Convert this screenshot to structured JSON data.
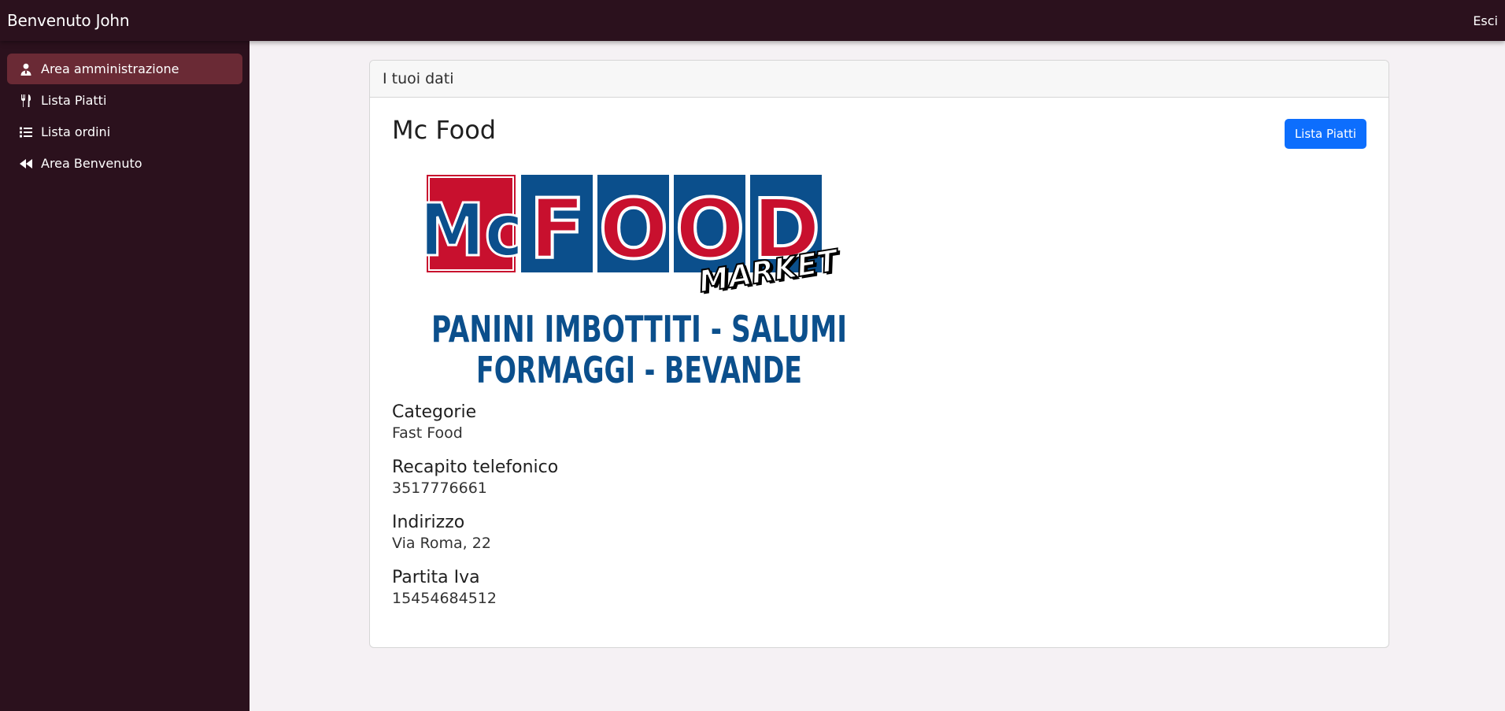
{
  "topbar": {
    "welcome": "Benvenuto John",
    "logout": "Esci"
  },
  "sidebar": {
    "items": [
      {
        "label": "Area amministrazione",
        "icon": "user-tie-icon",
        "active": true
      },
      {
        "label": "Lista Piatti",
        "icon": "utensils-icon",
        "active": false
      },
      {
        "label": "Lista ordini",
        "icon": "list-icon",
        "active": false
      },
      {
        "label": "Area Benvenuto",
        "icon": "backward-icon",
        "active": false
      }
    ]
  },
  "card": {
    "header": "I tuoi dati",
    "title": "Mc Food",
    "button": "Lista Piatti",
    "logo": {
      "word_mc": "Mc",
      "letters": [
        "F",
        "O",
        "O",
        "D"
      ],
      "tag": "MARKET",
      "line1": "PANINI IMBOTTITI - SALUMI",
      "line2": "FORMAGGI - BEVANDE"
    },
    "details": [
      {
        "label": "Categorie",
        "value": "Fast Food"
      },
      {
        "label": "Recapito telefonico",
        "value": "3517776661"
      },
      {
        "label": "Indirizzo",
        "value": "Via Roma, 22"
      },
      {
        "label": "Partita Iva",
        "value": "15454684512"
      }
    ]
  },
  "colors": {
    "sidebar_bg": "#2b111d",
    "active_item": "#6a2a35",
    "primary": "#0d6efd",
    "logo_red": "#c8102e",
    "logo_blue": "#0b4f8c"
  }
}
